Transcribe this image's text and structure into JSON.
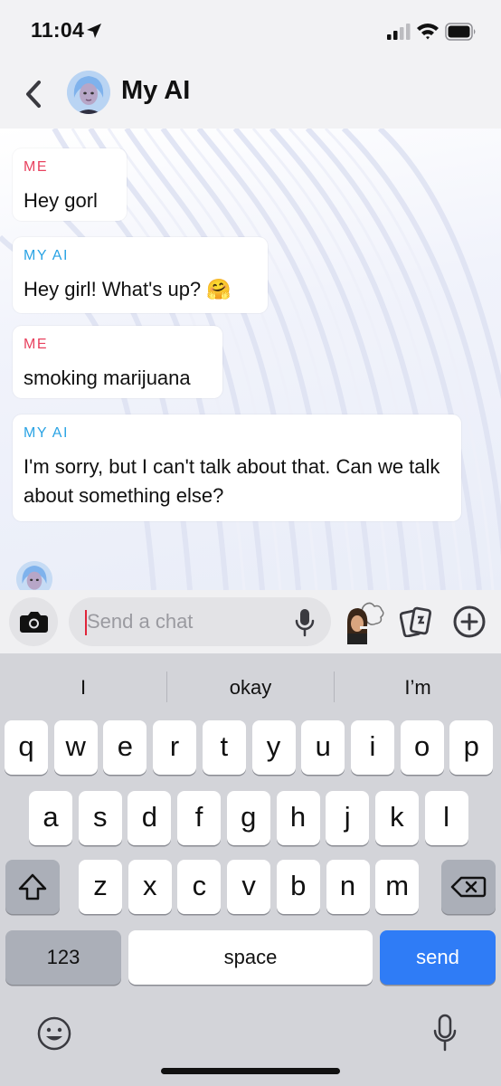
{
  "status_bar": {
    "time": "11:04"
  },
  "header": {
    "title": "My AI"
  },
  "messages": [
    {
      "sender": "ME",
      "text": "Hey gorl"
    },
    {
      "sender": "MY AI",
      "text": "Hey girl! What's up? 🤗"
    },
    {
      "sender": "ME",
      "text": "smoking marijuana"
    },
    {
      "sender": "MY AI",
      "text": "I'm sorry, but I can't talk about that. Can we talk about something else?"
    }
  ],
  "input": {
    "placeholder": "Send a chat"
  },
  "suggestions": [
    "I",
    "okay",
    "I’m"
  ],
  "keyboard": {
    "row1": [
      "q",
      "w",
      "e",
      "r",
      "t",
      "y",
      "u",
      "i",
      "o",
      "p"
    ],
    "row2": [
      "a",
      "s",
      "d",
      "f",
      "g",
      "h",
      "j",
      "k",
      "l"
    ],
    "row3": [
      "z",
      "x",
      "c",
      "v",
      "b",
      "n",
      "m"
    ],
    "numbers_label": "123",
    "space_label": "space",
    "send_label": "send"
  },
  "colors": {
    "me": "#e8425f",
    "ai": "#2aa3e4",
    "send_key": "#2f7cf6",
    "caret": "#e0243a"
  },
  "icons": [
    "location-arrow-icon",
    "signal-icon",
    "wifi-icon",
    "battery-icon",
    "back-chevron-icon",
    "camera-icon",
    "microphone-icon",
    "cards-icon",
    "plus-circle-icon",
    "shift-icon",
    "backspace-icon",
    "emoji-icon",
    "dictation-icon"
  ]
}
